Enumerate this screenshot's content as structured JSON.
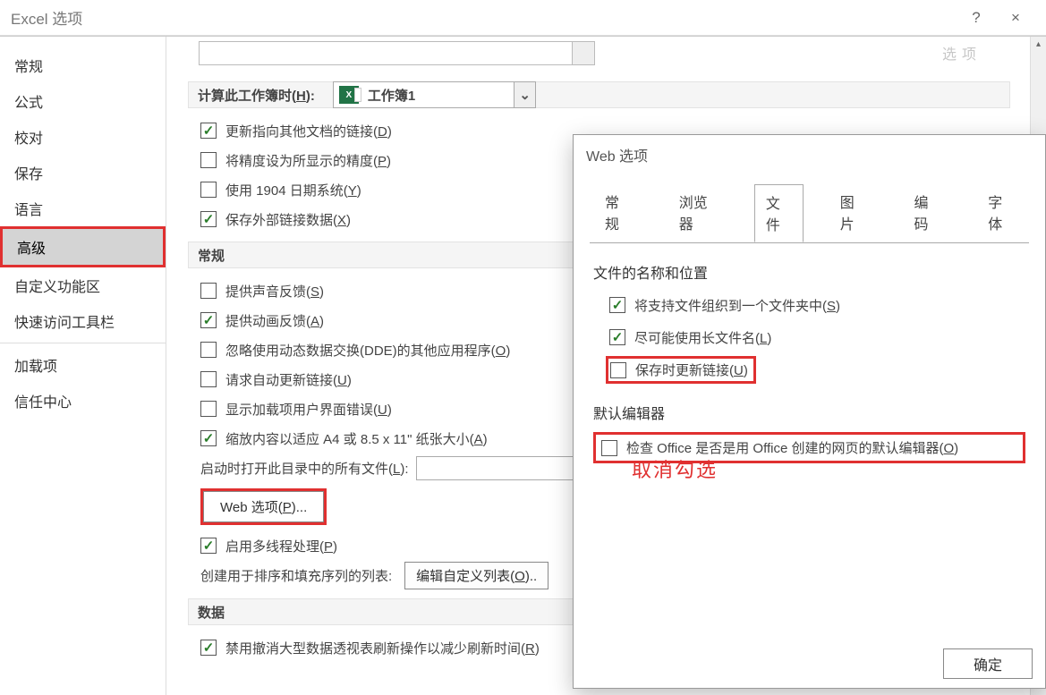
{
  "window": {
    "title": "Excel 选项",
    "help_icon": "?",
    "close_icon": "×"
  },
  "sidebar": {
    "items": [
      {
        "label": "常规"
      },
      {
        "label": "公式"
      },
      {
        "label": "校对"
      },
      {
        "label": "保存"
      },
      {
        "label": "语言"
      },
      {
        "label": "高级",
        "selected": true
      },
      {
        "label": "自定义功能区"
      },
      {
        "label": "快速访问工具栏"
      },
      {
        "label": "加载项"
      },
      {
        "label": "信任中心"
      }
    ]
  },
  "content": {
    "ghost_button": "选项",
    "calc_section_label": "计算此工作簿时(",
    "calc_section_hotkey": "H",
    "calc_section_tail": "):",
    "workbook_dropdown": "工作簿1",
    "calc_options": [
      {
        "checked": true,
        "text": "更新指向其他文档的链接(",
        "hk": "D",
        "tail": ")"
      },
      {
        "checked": false,
        "text": "将精度设为所显示的精度(",
        "hk": "P",
        "tail": ")"
      },
      {
        "checked": false,
        "text": "使用 1904 日期系统(",
        "hk": "Y",
        "tail": ")"
      },
      {
        "checked": true,
        "text": "保存外部链接数据(",
        "hk": "X",
        "tail": ")"
      }
    ],
    "general_header": "常规",
    "general_options": [
      {
        "checked": false,
        "text": "提供声音反馈(",
        "hk": "S",
        "tail": ")"
      },
      {
        "checked": true,
        "text": "提供动画反馈(",
        "hk": "A",
        "tail": ")"
      },
      {
        "checked": false,
        "text": "忽略使用动态数据交换(DDE)的其他应用程序(",
        "hk": "O",
        "tail": ")"
      },
      {
        "checked": false,
        "text": "请求自动更新链接(",
        "hk": "U",
        "tail": ")"
      },
      {
        "checked": false,
        "text": "显示加载项用户界面错误(",
        "hk": "U",
        "tail": ")"
      },
      {
        "checked": true,
        "text": "缩放内容以适应 A4 或 8.5 x 11\" 纸张大小(",
        "hk": "A",
        "tail": ")"
      }
    ],
    "startup_label": "启动时打开此目录中的所有文件(",
    "startup_hk": "L",
    "startup_tail": "):",
    "web_options_button": "Web 选项(",
    "web_options_hk": "P",
    "web_options_tail": ")...",
    "multi_thread": {
      "checked": true,
      "text": "启用多线程处理(",
      "hk": "P",
      "tail": ")"
    },
    "sort_label": "创建用于排序和填充序列的列表:",
    "sort_button": "编辑自定义列表(",
    "sort_hk": "O",
    "sort_tail": ")..",
    "data_header": "数据",
    "data_option": {
      "checked": true,
      "text": "禁用撤消大型数据透视表刷新操作以减少刷新时间(",
      "hk": "R",
      "tail": ")"
    }
  },
  "dialog": {
    "title": "Web 选项",
    "tabs": [
      "常规",
      "浏览器",
      "文件",
      "图片",
      "编码",
      "字体"
    ],
    "active_tab": "文件",
    "group1": "文件的名称和位置",
    "opts1": [
      {
        "checked": true,
        "text": "将支持文件组织到一个文件夹中(",
        "hk": "S",
        "tail": ")"
      },
      {
        "checked": true,
        "text": "尽可能使用长文件名(",
        "hk": "L",
        "tail": ")"
      },
      {
        "checked": false,
        "text": "保存时更新链接(",
        "hk": "U",
        "tail": ")",
        "red": true
      }
    ],
    "group2": "默认编辑器",
    "opts2": [
      {
        "checked": false,
        "text": "检查 Office 是否是用 Office 创建的网页的默认编辑器(",
        "hk": "O",
        "tail": ")",
        "redwide": true
      }
    ],
    "ok": "确定"
  },
  "annotation": "取消勾选"
}
